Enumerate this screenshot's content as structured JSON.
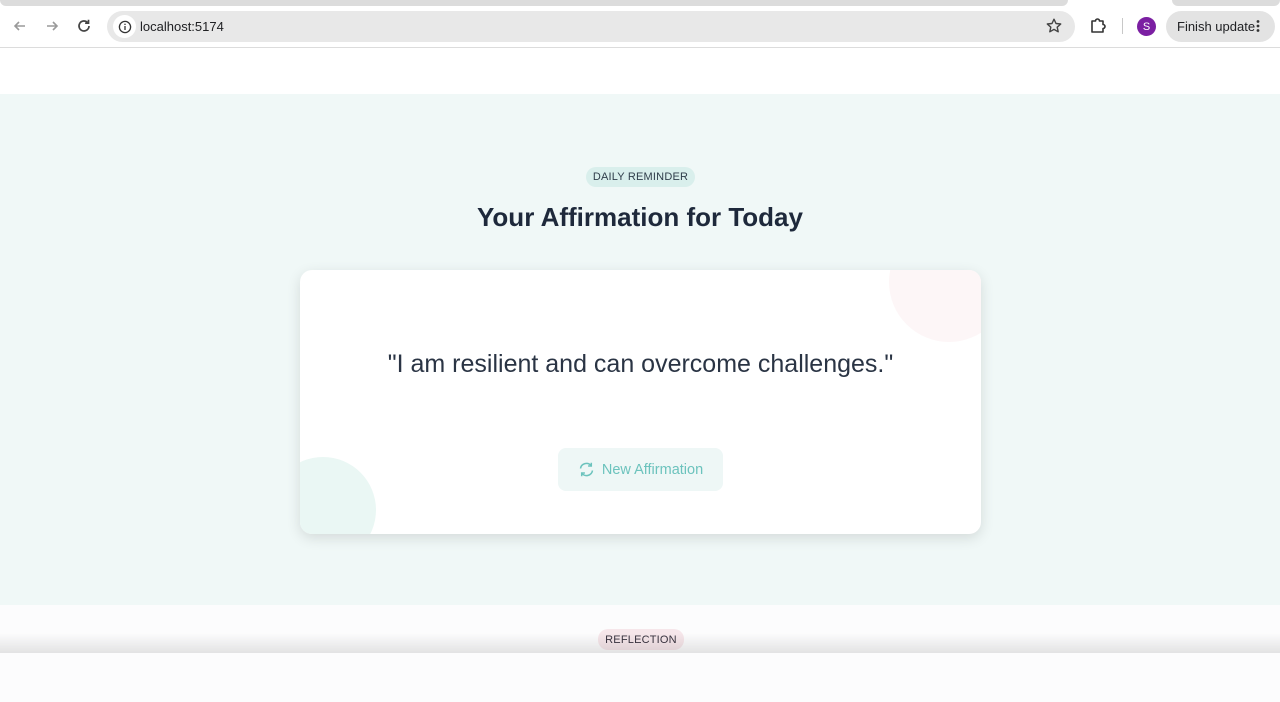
{
  "browser": {
    "url": "localhost:5174",
    "avatar_letter": "S",
    "finish_update_label": "Finish update",
    "avatar_color": "#7b1fa2"
  },
  "hero": {
    "badge": "DAILY REMINDER",
    "title": "Your Affirmation for Today",
    "quote": "\"I am resilient and can overcome challenges.\"",
    "new_button_label": "New Affirmation",
    "background_color": "#f0f8f7",
    "accent_color": "#6cc3bd"
  },
  "reflection": {
    "badge": "REFLECTION"
  },
  "icons": [
    "back-arrow-icon",
    "forward-arrow-icon",
    "reload-icon",
    "site-info-icon",
    "star-icon",
    "extensions-icon",
    "more-vert-icon",
    "refresh-icon"
  ]
}
